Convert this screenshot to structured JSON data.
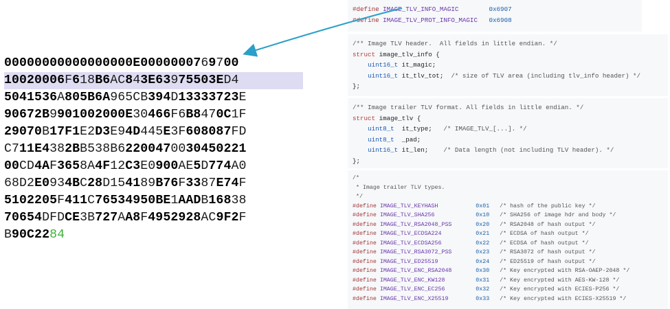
{
  "hex_dump": {
    "lines": [
      [
        [
          "b",
          "00000000000000000"
        ],
        [
          "n",
          ""
        ],
        [
          "b",
          "E"
        ],
        [
          "b",
          "000000"
        ],
        [
          "b",
          "07"
        ],
        [
          "n",
          "6"
        ],
        [
          "b",
          "9"
        ],
        [
          "n",
          "7"
        ],
        [
          "b",
          "00"
        ]
      ],
      [
        [
          "b",
          "1"
        ],
        [
          "n",
          ""
        ],
        [
          "b",
          "0020006"
        ],
        [
          "n",
          "F"
        ],
        [
          "b",
          "6"
        ],
        [
          "n",
          "18"
        ],
        [
          "b",
          "B6"
        ],
        [
          "n",
          "AC"
        ],
        [
          "b",
          "8"
        ],
        [
          "n",
          "4"
        ],
        [
          "b",
          "3"
        ],
        [
          "b",
          "E63"
        ],
        [
          "n",
          "9"
        ],
        [
          "b",
          "75503"
        ],
        [
          "b",
          "E"
        ],
        [
          "n",
          "D4"
        ]
      ],
      [
        [
          "b",
          "5041536"
        ],
        [
          "n",
          "A"
        ],
        [
          "b",
          "805"
        ],
        [
          "b",
          "B6A"
        ],
        [
          "n",
          "965"
        ],
        [
          "n",
          "CB"
        ],
        [
          "b",
          "394"
        ],
        [
          "n",
          "D"
        ],
        [
          "b",
          "1333"
        ],
        [
          "b",
          "3723"
        ],
        [
          "n",
          "E"
        ]
      ],
      [
        [
          "b",
          "90672"
        ],
        [
          "b",
          "B"
        ],
        [
          "n",
          "9"
        ],
        [
          "b",
          "9010020"
        ],
        [
          "b",
          "00"
        ],
        [
          "b",
          "E"
        ],
        [
          "n",
          "30"
        ],
        [
          "b",
          "466"
        ],
        [
          "n",
          "F6"
        ],
        [
          "b",
          "B8"
        ],
        [
          "n",
          "47"
        ],
        [
          "b",
          "0C"
        ],
        [
          "n",
          "1F"
        ]
      ],
      [
        [
          "b",
          "29070"
        ],
        [
          "n",
          "B"
        ],
        [
          "b",
          "17"
        ],
        [
          "b",
          "F1"
        ],
        [
          "n",
          "E2"
        ],
        [
          "b",
          "D3"
        ],
        [
          "n",
          "E9"
        ],
        [
          "b",
          "4D"
        ],
        [
          "n",
          "445"
        ],
        [
          "b",
          "E"
        ],
        [
          "n",
          "3F"
        ],
        [
          "b",
          "608087"
        ],
        [
          "n",
          "FD"
        ]
      ],
      [
        [
          "n",
          "C7"
        ],
        [
          "b",
          "11"
        ],
        [
          "b",
          "E4"
        ],
        [
          "n",
          "38"
        ],
        [
          "b",
          "2B"
        ],
        [
          "n",
          "B538"
        ],
        [
          "n",
          "B6"
        ],
        [
          "b",
          "2200"
        ],
        [
          "b",
          "47"
        ],
        [
          "n",
          "00"
        ],
        [
          "b",
          "30450221"
        ]
      ],
      [
        [
          "b",
          "00"
        ],
        [
          "n",
          "CD"
        ],
        [
          "b",
          "4A"
        ],
        [
          "n",
          "F"
        ],
        [
          "b",
          "365"
        ],
        [
          "n",
          "8A"
        ],
        [
          "b",
          "4"
        ],
        [
          "b",
          "F"
        ],
        [
          "n",
          "12"
        ],
        [
          "b",
          "C3"
        ],
        [
          "n",
          "E0"
        ],
        [
          "b",
          "900"
        ],
        [
          "n",
          "AE"
        ],
        [
          "b",
          "5"
        ],
        [
          "n",
          "D"
        ],
        [
          "b",
          "774"
        ],
        [
          "n",
          "A0"
        ]
      ],
      [
        [
          "n",
          "68D2"
        ],
        [
          "b",
          "E0"
        ],
        [
          "n",
          "93"
        ],
        [
          "b",
          "4B"
        ],
        [
          "n",
          "C"
        ],
        [
          "b",
          "28"
        ],
        [
          "n",
          "D"
        ],
        [
          "n",
          "15"
        ],
        [
          "b",
          "41"
        ],
        [
          "n",
          "89"
        ],
        [
          "b",
          "B76"
        ],
        [
          "n",
          "F"
        ],
        [
          "b",
          "33"
        ],
        [
          "n",
          "87"
        ],
        [
          "b",
          "E74"
        ],
        [
          "n",
          "F"
        ]
      ],
      [
        [
          "b",
          "5102205"
        ],
        [
          "n",
          "F"
        ],
        [
          "b",
          "41"
        ],
        [
          "b",
          "1"
        ],
        [
          "n",
          "C"
        ],
        [
          "b",
          "76534950"
        ],
        [
          "b",
          "BE"
        ],
        [
          "n",
          "1"
        ],
        [
          "b",
          "A"
        ],
        [
          "b",
          "AD"
        ],
        [
          "n",
          "B"
        ],
        [
          "b",
          "168"
        ],
        [
          "n",
          "38"
        ]
      ],
      [
        [
          "b",
          "70654"
        ],
        [
          "n",
          "DFD"
        ],
        [
          "b",
          "CE"
        ],
        [
          "n",
          "3B"
        ],
        [
          "b",
          "727"
        ],
        [
          "n",
          "A"
        ],
        [
          "b",
          "A8"
        ],
        [
          "n",
          "F"
        ],
        [
          "b",
          "4952928"
        ],
        [
          "n",
          "AC"
        ],
        [
          "b",
          "9"
        ],
        [
          "b",
          "F2"
        ],
        [
          "n",
          "F"
        ]
      ],
      [
        [
          "n",
          "B"
        ],
        [
          "b",
          "90C22"
        ],
        [
          "g",
          "84"
        ]
      ]
    ]
  },
  "code": {
    "magic": [
      [
        [
          "pp",
          "#define"
        ],
        [
          "tx",
          " "
        ],
        [
          "mac",
          "IMAGE_TLV_INFO_MAGIC"
        ],
        [
          "tx",
          "        "
        ],
        [
          "num",
          "0x6907"
        ]
      ],
      [
        [
          "pp",
          "#define"
        ],
        [
          "tx",
          " "
        ],
        [
          "mac",
          "IMAGE_TLV_PROT_INFO_MAGIC"
        ],
        [
          "tx",
          "   "
        ],
        [
          "num",
          "0x6908"
        ]
      ]
    ],
    "info": [
      [
        [
          "cm",
          "/** Image TLV header.  All fields in little endian. */"
        ]
      ],
      [
        [
          "kw",
          "struct"
        ],
        [
          "tx",
          " image_tlv_info {"
        ]
      ],
      [
        [
          "tx",
          "    "
        ],
        [
          "ty",
          "uint16_t"
        ],
        [
          "tx",
          " it_magic;"
        ]
      ],
      [
        [
          "tx",
          "    "
        ],
        [
          "ty",
          "uint16_t"
        ],
        [
          "tx",
          " it_tlv_tot;  "
        ],
        [
          "cm",
          "/* size of TLV area (including tlv_info header) */"
        ]
      ],
      [
        [
          "tx",
          "};"
        ]
      ]
    ],
    "tlv": [
      [
        [
          "cm",
          "/** Image trailer TLV format. All fields in little endian. */"
        ]
      ],
      [
        [
          "kw",
          "struct"
        ],
        [
          "tx",
          " image_tlv {"
        ]
      ],
      [
        [
          "tx",
          "    "
        ],
        [
          "ty",
          "uint8_t"
        ],
        [
          "tx",
          "  it_type;   "
        ],
        [
          "cm",
          "/* IMAGE_TLV_[...]. */"
        ]
      ],
      [
        [
          "tx",
          "    "
        ],
        [
          "ty",
          "uint8_t"
        ],
        [
          "tx",
          "  _pad;"
        ]
      ],
      [
        [
          "tx",
          "    "
        ],
        [
          "ty",
          "uint16_t"
        ],
        [
          "tx",
          " it_len;    "
        ],
        [
          "cm",
          "/* Data length (not including TLV header). */"
        ]
      ],
      [
        [
          "tx",
          "};"
        ]
      ]
    ],
    "types": [
      [
        [
          "cm",
          "/*"
        ]
      ],
      [
        [
          "cm",
          " * Image trailer TLV types."
        ]
      ],
      [
        [
          "cm",
          " */"
        ]
      ],
      [
        [
          "pp",
          "#define"
        ],
        [
          "tx",
          " "
        ],
        [
          "mac",
          "IMAGE_TLV_KEYHASH"
        ],
        [
          "tx",
          "           "
        ],
        [
          "num",
          "0x01"
        ],
        [
          "tx",
          "   "
        ],
        [
          "cm",
          "/* hash of the public key */"
        ]
      ],
      [
        [
          "pp",
          "#define"
        ],
        [
          "tx",
          " "
        ],
        [
          "mac",
          "IMAGE_TLV_SHA256"
        ],
        [
          "tx",
          "            "
        ],
        [
          "num",
          "0x10"
        ],
        [
          "tx",
          "   "
        ],
        [
          "cm",
          "/* SHA256 of image hdr and body */"
        ]
      ],
      [
        [
          "pp",
          "#define"
        ],
        [
          "tx",
          " "
        ],
        [
          "mac",
          "IMAGE_TLV_RSA2048_PSS"
        ],
        [
          "tx",
          "       "
        ],
        [
          "num",
          "0x20"
        ],
        [
          "tx",
          "   "
        ],
        [
          "cm",
          "/* RSA2048 of hash output */"
        ]
      ],
      [
        [
          "pp",
          "#define"
        ],
        [
          "tx",
          " "
        ],
        [
          "mac",
          "IMAGE_TLV_ECDSA224"
        ],
        [
          "tx",
          "          "
        ],
        [
          "num",
          "0x21"
        ],
        [
          "tx",
          "   "
        ],
        [
          "cm",
          "/* ECDSA of hash output */"
        ]
      ],
      [
        [
          "pp",
          "#define"
        ],
        [
          "tx",
          " "
        ],
        [
          "mac",
          "IMAGE_TLV_ECDSA256"
        ],
        [
          "tx",
          "          "
        ],
        [
          "num",
          "0x22"
        ],
        [
          "tx",
          "   "
        ],
        [
          "cm",
          "/* ECDSA of hash output */"
        ]
      ],
      [
        [
          "pp",
          "#define"
        ],
        [
          "tx",
          " "
        ],
        [
          "mac",
          "IMAGE_TLV_RSA3072_PSS"
        ],
        [
          "tx",
          "       "
        ],
        [
          "num",
          "0x23"
        ],
        [
          "tx",
          "   "
        ],
        [
          "cm",
          "/* RSA3072 of hash output */"
        ]
      ],
      [
        [
          "pp",
          "#define"
        ],
        [
          "tx",
          " "
        ],
        [
          "mac",
          "IMAGE_TLV_ED25519"
        ],
        [
          "tx",
          "           "
        ],
        [
          "num",
          "0x24"
        ],
        [
          "tx",
          "   "
        ],
        [
          "cm",
          "/* ED25519 of hash output */"
        ]
      ],
      [
        [
          "pp",
          "#define"
        ],
        [
          "tx",
          " "
        ],
        [
          "mac",
          "IMAGE_TLV_ENC_RSA2048"
        ],
        [
          "tx",
          "       "
        ],
        [
          "num",
          "0x30"
        ],
        [
          "tx",
          "   "
        ],
        [
          "cm",
          "/* Key encrypted with RSA-OAEP-2048 */"
        ]
      ],
      [
        [
          "pp",
          "#define"
        ],
        [
          "tx",
          " "
        ],
        [
          "mac",
          "IMAGE_TLV_ENC_KW128"
        ],
        [
          "tx",
          "         "
        ],
        [
          "num",
          "0x31"
        ],
        [
          "tx",
          "   "
        ],
        [
          "cm",
          "/* Key encrypted with AES-KW-128 */"
        ]
      ],
      [
        [
          "pp",
          "#define"
        ],
        [
          "tx",
          " "
        ],
        [
          "mac",
          "IMAGE_TLV_ENC_EC256"
        ],
        [
          "tx",
          "         "
        ],
        [
          "num",
          "0x32"
        ],
        [
          "tx",
          "   "
        ],
        [
          "cm",
          "/* Key encrypted with ECIES-P256 */"
        ]
      ],
      [
        [
          "pp",
          "#define"
        ],
        [
          "tx",
          " "
        ],
        [
          "mac",
          "IMAGE_TLV_ENC_X25519"
        ],
        [
          "tx",
          "        "
        ],
        [
          "num",
          "0x33"
        ],
        [
          "tx",
          "   "
        ],
        [
          "cm",
          "/* Key encrypted with ECIES-X25519 */"
        ]
      ]
    ]
  },
  "colors": {
    "highlight": "#dedcf2",
    "arrow": "#2a9fc9",
    "green_digits": "#3db33a"
  }
}
